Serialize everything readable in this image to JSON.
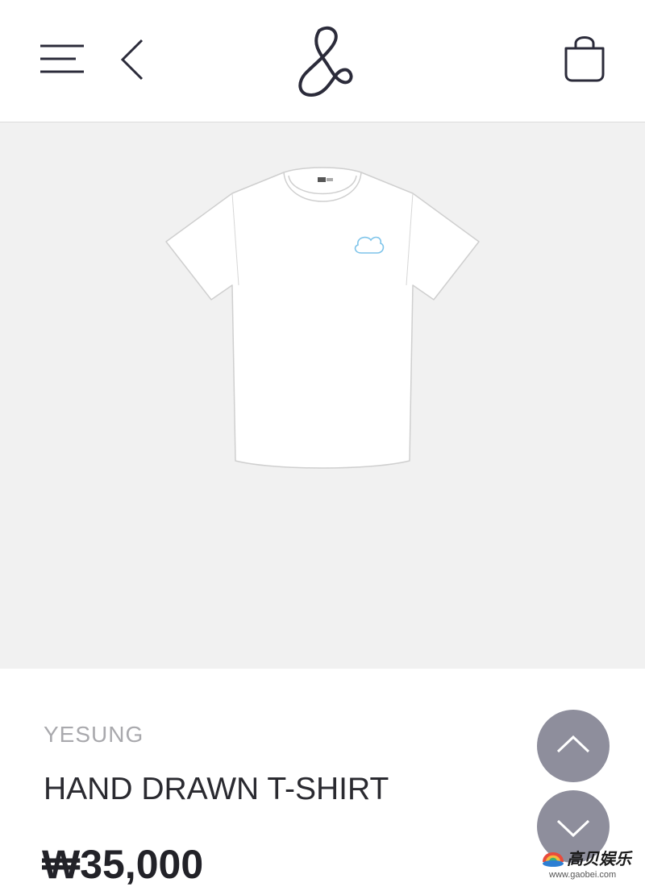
{
  "header": {
    "menu_icon": "hamburger-menu-icon",
    "back_icon": "chevron-left-icon",
    "logo_icon": "ampersand-logo",
    "bag_icon": "shopping-bag-icon"
  },
  "product": {
    "image_icon": "t-shirt-product-image",
    "artist": "YESUNG",
    "name": "HAND DRAWN T-SHIRT",
    "price": "₩35,000"
  },
  "controls": {
    "scroll_up_icon": "chevron-up-icon",
    "scroll_down_icon": "chevron-down-icon"
  },
  "watermark": {
    "text": "高贝娱乐",
    "url": "www.gaobei.com"
  },
  "colors": {
    "header_bg": "#ffffff",
    "hero_bg": "#f1f1f1",
    "icon_stroke": "#2b2b3a",
    "artist_text": "#a9a9ad",
    "name_text": "#2a2a30",
    "price_text": "#222228",
    "fab_bg": "#8e8e9c",
    "shirt_logo": "#7ec4ea"
  }
}
